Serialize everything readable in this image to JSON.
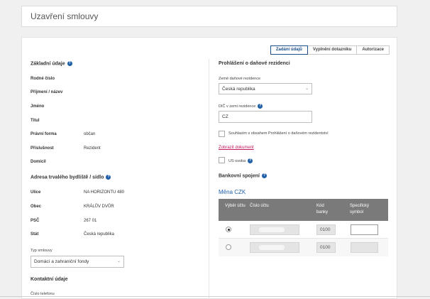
{
  "page": {
    "title": "Uzavření smlouvy"
  },
  "steps": [
    "Zadání údajů",
    "Vyplnění dotazníku",
    "Autorizace"
  ],
  "left": {
    "basic_heading": "Základní údaje",
    "fields": [
      {
        "label": "Rodné číslo",
        "value": ""
      },
      {
        "label": "Příjmení / název",
        "value": ""
      },
      {
        "label": "Jméno",
        "value": ""
      },
      {
        "label": "Titul",
        "value": ""
      },
      {
        "label": "Právní forma",
        "value": "občan"
      },
      {
        "label": "Příslušnost",
        "value": "Rezident"
      },
      {
        "label": "Domicil",
        "value": ""
      }
    ],
    "address_heading": "Adresa trvalého bydliště / sídlo",
    "address": [
      {
        "label": "Ulice",
        "value": "NA HORIZONTU 480"
      },
      {
        "label": "Obec",
        "value": "KRÁLŮV DVŮR"
      },
      {
        "label": "PSČ",
        "value": "267 01"
      },
      {
        "label": "Stát",
        "value": "Česká republika"
      }
    ],
    "contract_type_label": "Typ smlouvy",
    "contract_type_value": "Domácí a zahraniční fondy",
    "contact_heading": "Kontaktní údaje",
    "phone_label": "Číslo telefonu"
  },
  "right": {
    "tax_heading": "Prohlášení o daňové rezidenci",
    "country_label": "Země daňové rezidence",
    "country_value": "Česká republika",
    "tin_label": "DIČ v zemi rezidence",
    "tin_value": "CZ",
    "consent_label": "Souhlasím s obsahem Prohlášení o daňovém rezidentství",
    "doc_link": "Zobrazit dokument",
    "us_label": "US osoba",
    "bank_heading": "Bankovní spojení",
    "currency": "Měna CZK",
    "table": {
      "headers": [
        "Výběr účtu",
        "Číslo účtu",
        "Kód banky",
        "Specifický symbol"
      ],
      "rows": [
        {
          "selected": true,
          "bank_code": "0100"
        },
        {
          "selected": false,
          "bank_code": "0100"
        }
      ]
    }
  }
}
